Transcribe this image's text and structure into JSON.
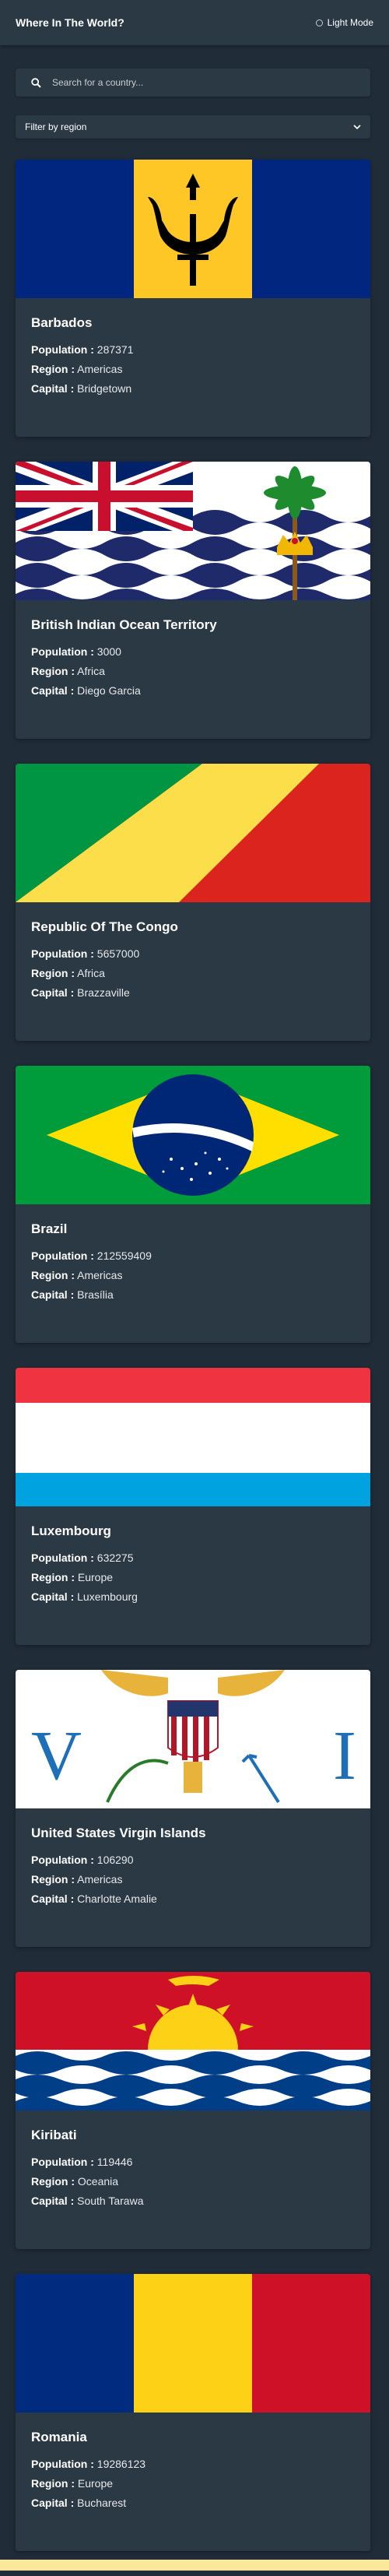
{
  "header": {
    "title": "Where In The World?",
    "theme_label": "Light Mode",
    "theme_icon": "moon-icon"
  },
  "search": {
    "placeholder": "Search for a country...",
    "value": "",
    "icon": "search-icon"
  },
  "filter": {
    "label": "Filter by region",
    "icon": "chevron-down-icon"
  },
  "labels": {
    "population": "Population :",
    "region": "Region :",
    "capital": "Capital :"
  },
  "countries": [
    {
      "name": "Barbados",
      "population": "287371",
      "region": "Americas",
      "capital": "Bridgetown"
    },
    {
      "name": "British Indian Ocean Territory",
      "population": "3000",
      "region": "Africa",
      "capital": "Diego Garcia"
    },
    {
      "name": "Republic Of The Congo",
      "population": "5657000",
      "region": "Africa",
      "capital": "Brazzaville"
    },
    {
      "name": "Brazil",
      "population": "212559409",
      "region": "Americas",
      "capital": "Brasília"
    },
    {
      "name": "Luxembourg",
      "population": "632275",
      "region": "Europe",
      "capital": "Luxembourg"
    },
    {
      "name": "United States Virgin Islands",
      "population": "106290",
      "region": "Americas",
      "capital": "Charlotte Amalie"
    },
    {
      "name": "Kiribati",
      "population": "119446",
      "region": "Oceania",
      "capital": "South Tarawa"
    },
    {
      "name": "Romania",
      "population": "19286123",
      "region": "Europe",
      "capital": "Bucharest"
    }
  ],
  "colors": {
    "background": "#202c37",
    "element": "#2b3945",
    "text": "#ffffff"
  }
}
